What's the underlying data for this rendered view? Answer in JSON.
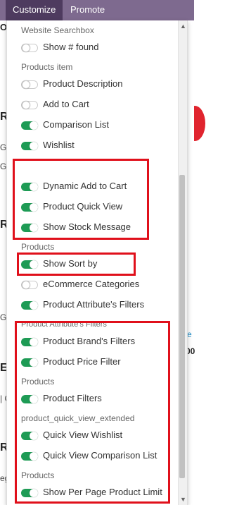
{
  "topbar": {
    "tabs": [
      "Customize",
      "Promote"
    ]
  },
  "background": {
    "fragments": [
      "O",
      "R",
      "GE",
      "GE",
      "R",
      "G",
      "ES",
      "| C",
      "R",
      "eg",
      "S",
      "e",
      "00"
    ]
  },
  "panel": {
    "sections": [
      {
        "header": "Website Searchbox",
        "items": [
          {
            "label": "Show # found",
            "on": false
          }
        ]
      },
      {
        "header": "Products item",
        "items": [
          {
            "label": "Product Description",
            "on": false
          },
          {
            "label": "Add to Cart",
            "on": false
          },
          {
            "label": "Comparison List",
            "on": true
          },
          {
            "label": "Wishlist",
            "on": true
          },
          {
            "label": "Dynamic Add to Cart",
            "on": true
          },
          {
            "label": "Product Quick View",
            "on": true
          },
          {
            "label": "Show Stock Message",
            "on": true
          }
        ]
      },
      {
        "header": "Products",
        "items": [
          {
            "label": "Show Sort by",
            "on": true
          },
          {
            "label": "eCommerce Categories",
            "on": false
          },
          {
            "label": "Product Attribute's Filters",
            "on": true
          }
        ]
      },
      {
        "header": "Product Attribute's Filters",
        "items": [
          {
            "label": "Product Brand's Filters",
            "on": true
          },
          {
            "label": "Product Price Filter",
            "on": true
          }
        ]
      },
      {
        "header": "Products",
        "items": [
          {
            "label": "Product Filters",
            "on": true
          }
        ]
      },
      {
        "header": "product_quick_view_extended",
        "items": [
          {
            "label": "Quick View Wishlist",
            "on": true
          },
          {
            "label": "Quick View Comparison List",
            "on": true
          }
        ]
      },
      {
        "header": "Products",
        "items": [
          {
            "label": "Show Per Page Product Limit",
            "on": true
          }
        ]
      }
    ]
  },
  "colors": {
    "toggle_on": "#1e9b55",
    "highlight": "#e0101b",
    "topbar": "#7e6a8f",
    "active_tab": "#4e3b5f"
  }
}
